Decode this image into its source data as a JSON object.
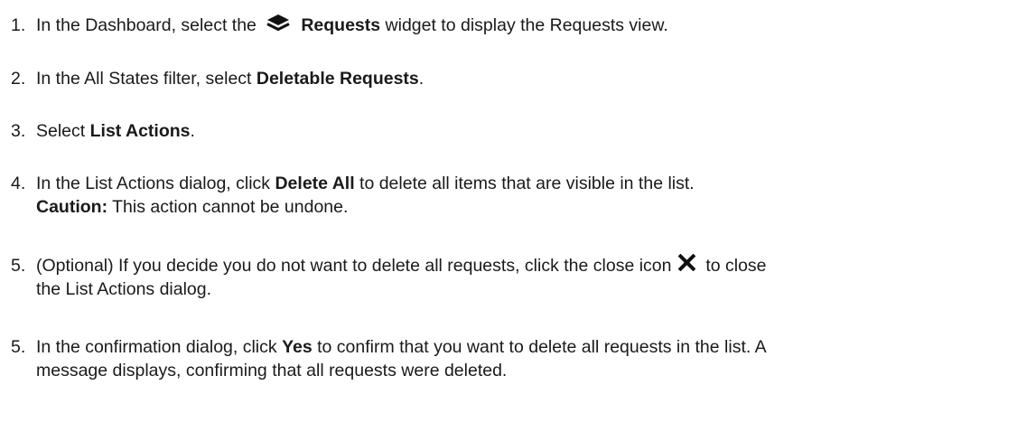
{
  "steps": [
    {
      "number": "1.",
      "parts": {
        "a": "In the Dashboard, select the ",
        "icon": "layers-icon",
        "b": "Requests",
        "c": " widget to display the Requests view."
      }
    },
    {
      "number": "2.",
      "parts": {
        "a": "In the All States filter, select ",
        "b": "Deletable Requests",
        "c": "."
      }
    },
    {
      "number": "3.",
      "parts": {
        "a": "Select ",
        "b": "List Actions",
        "c": "."
      }
    },
    {
      "number": "4.",
      "parts": {
        "a": "In the List Actions dialog, click ",
        "b": "Delete All",
        "c": " to delete all items that are visible in the list.",
        "caution_label": "Caution:",
        "caution_text": " This action cannot be undone."
      }
    },
    {
      "number": "5.",
      "parts": {
        "a": "(Optional) If you decide you do not want to delete all requests, click the close icon ",
        "icon": "close-icon",
        "b": " to close",
        "c": "the List Actions dialog."
      }
    },
    {
      "number": "5.",
      "parts": {
        "a": "In the confirmation dialog, click ",
        "b": "Yes",
        "c": " to confirm that you want to delete all requests in the list. A",
        "d": "message displays, confirming that all requests were deleted."
      }
    }
  ]
}
